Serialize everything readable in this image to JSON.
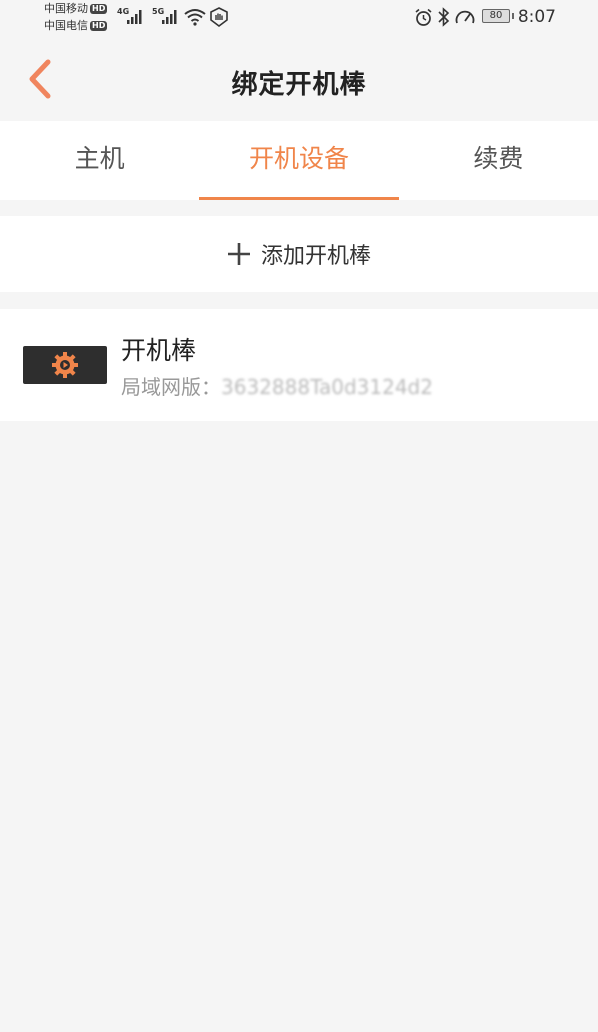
{
  "status_bar": {
    "carrier_1": "中国移动",
    "carrier_2": "中国电信",
    "hd_badge": "HD",
    "network_1": "4G",
    "network_2": "5G",
    "battery": "80",
    "time": "8:07"
  },
  "header": {
    "title": "绑定开机棒"
  },
  "tabs": [
    {
      "label": "主机"
    },
    {
      "label": "开机设备"
    },
    {
      "label": "续费"
    }
  ],
  "add_device": {
    "label": "添加开机棒"
  },
  "device": {
    "name": "开机棒",
    "subtitle_label": "局域网版：",
    "id_value": "3632888Ta0d3124d2"
  },
  "colors": {
    "accent": "#f0854a",
    "background": "#f5f5f5",
    "card": "#ffffff"
  }
}
